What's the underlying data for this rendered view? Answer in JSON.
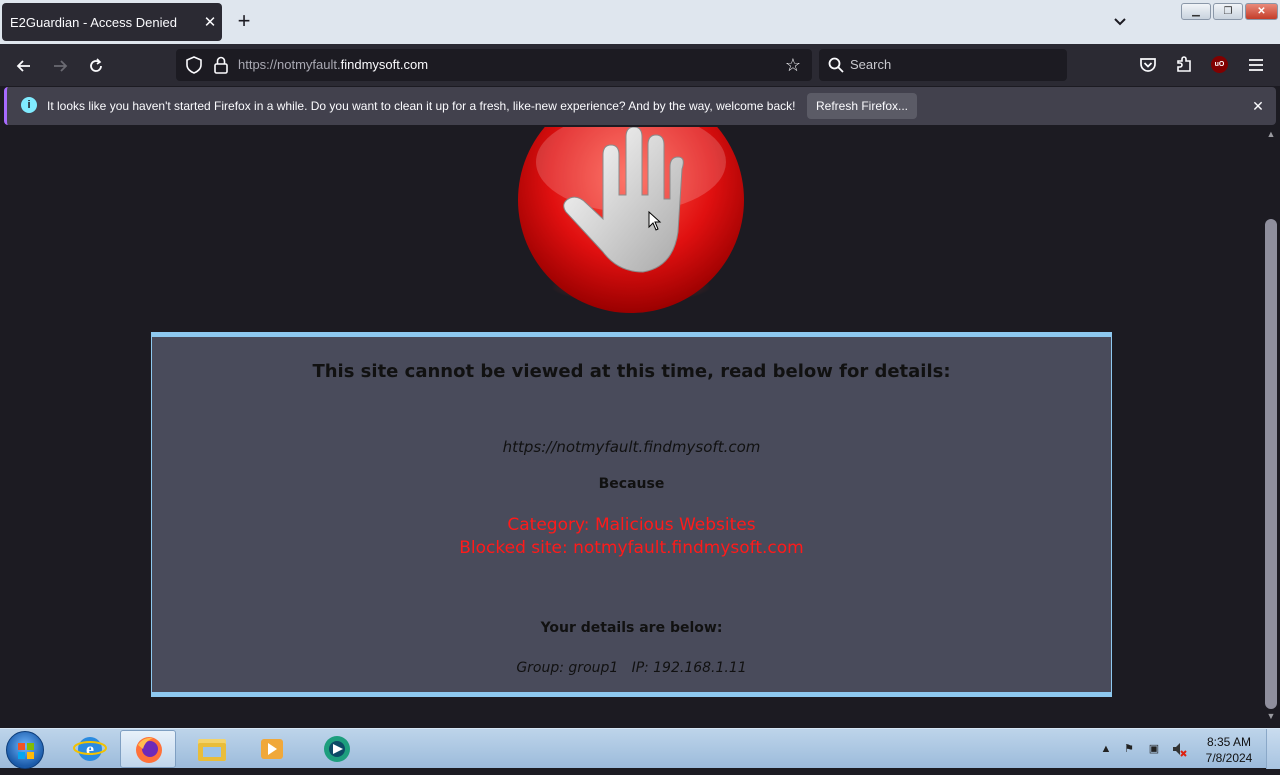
{
  "browser": {
    "tab_title": "E2Guardian - Access Denied",
    "url_prefix": "https://notmyfault.",
    "url_domain": "findmysoft.com",
    "search_placeholder": "Search"
  },
  "notification": {
    "message": "It looks like you haven't started Firefox in a while. Do you want to clean it up for a fresh, like-new experience? And by the way, welcome back!",
    "button_label": "Refresh Firefox..."
  },
  "page": {
    "heading": "This site cannot be viewed at this time, read below for details:",
    "blocked_url": "https://notmyfault.findmysoft.com",
    "because_label": "Because",
    "category": "Category: Malicious Websites",
    "blocked_site": "Blocked site: notmyfault.findmysoft.com",
    "details_heading": "Your details are below:",
    "details": "Group: group1   IP: 192.168.1.11"
  },
  "taskbar": {
    "time": "8:35 AM",
    "date": "7/8/2024"
  },
  "icons": {
    "ublock": "uO"
  },
  "colors": {
    "panel_bg": "#494b5b",
    "panel_border": "#8ec9f0",
    "alert_text": "#ff1a1a"
  }
}
